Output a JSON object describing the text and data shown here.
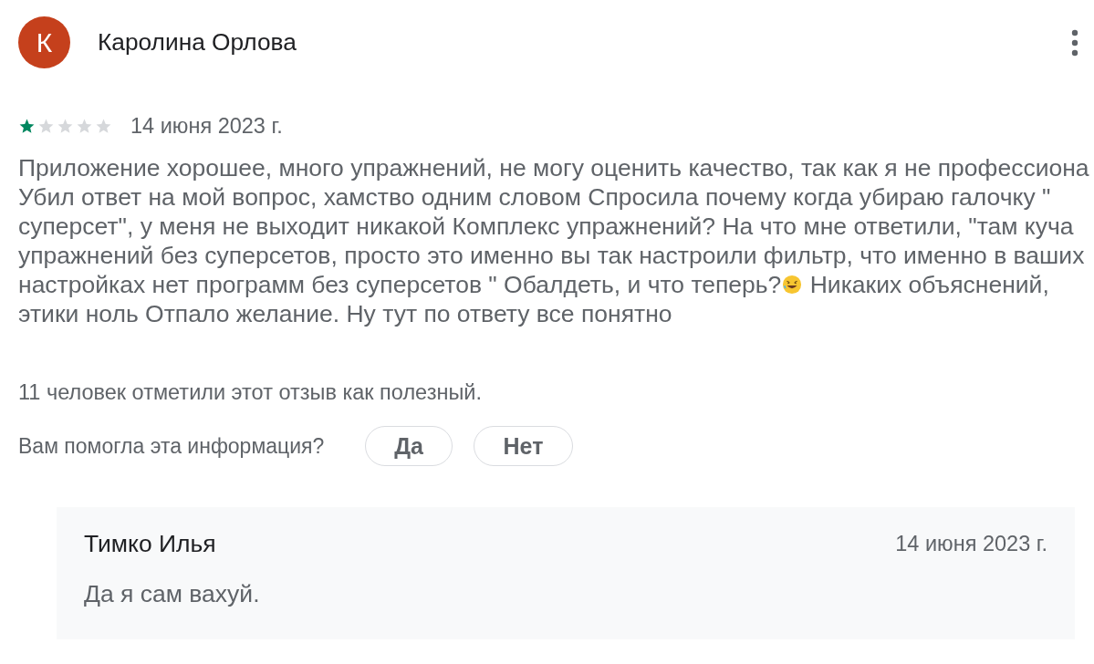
{
  "review": {
    "avatar_letter": "К",
    "author": "Каролина Орлова",
    "stars": 1,
    "date": "14 июня 2023 г.",
    "lines": [
      [
        {
          "kind": "text",
          "text": "Приложение хорошее, много упражнений, не могу оценить качество, так как я не профессиона"
        }
      ],
      [
        {
          "kind": "text",
          "text": "Убил ответ на мой вопрос, хамство одним словом Спросила почему когда убираю галочку \""
        }
      ],
      [
        {
          "kind": "text",
          "text": "суперсет\", у меня не выходит никакой Комплекс упражнений? На что мне ответили, \"там куча"
        }
      ],
      [
        {
          "kind": "text",
          "text": "упражнений без суперсетов, просто это именно вы так настроили фильтр, что именно в ваших"
        }
      ],
      [
        {
          "kind": "text",
          "text": "настройках нет программ без суперсетов \" Обалдеть, и что теперь?"
        },
        {
          "kind": "emoji"
        },
        {
          "kind": "text",
          "text": " Никаких объяснений,"
        }
      ],
      [
        {
          "kind": "text",
          "text": "этики ноль Отпало желание. Ну тут по ответу все понятно"
        }
      ]
    ],
    "helpful_count": "11 человек отметили этот отзыв как полезный.",
    "helpful_question": "Вам помогла эта информация?",
    "buttons": [
      "Да",
      "Нет"
    ]
  },
  "reply": {
    "author": "Тимко Илья",
    "date": "14 июня 2023 г.",
    "text": "Да я сам вахуй."
  }
}
